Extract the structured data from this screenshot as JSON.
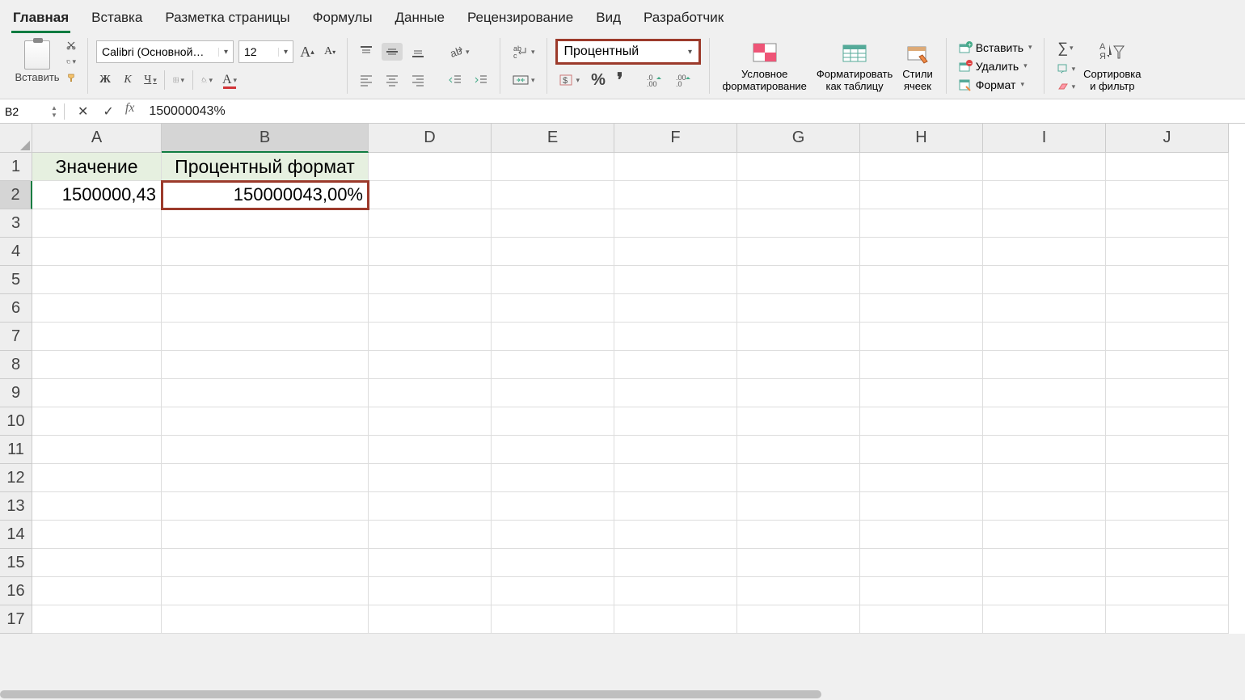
{
  "tabs": [
    "Главная",
    "Вставка",
    "Разметка страницы",
    "Формулы",
    "Данные",
    "Рецензирование",
    "Вид",
    "Разработчик"
  ],
  "active_tab": 0,
  "paste_label": "Вставить",
  "font_name": "Calibri (Основной…",
  "font_size": "12",
  "bold": "Ж",
  "italic": "К",
  "underline": "Ч",
  "number_format": "Процентный",
  "cond_format": "Условное\nформатирование",
  "format_table": "Форматировать\nкак таблицу",
  "cell_styles": "Стили\nячеек",
  "insert_cells": "Вставить",
  "delete_cells": "Удалить",
  "format_cells": "Формат",
  "sort_filter": "Сортировка\nи фильтр",
  "namebox": "B2",
  "formula": "150000043%",
  "columns": [
    "A",
    "B",
    "D",
    "E",
    "F",
    "G",
    "H",
    "I",
    "J"
  ],
  "row_count": 17,
  "cells": {
    "A1": "Значение",
    "B1": "Процентный формат",
    "A2": "1500000,43",
    "B2": "150000043,00%"
  },
  "selected_cell": "B2"
}
